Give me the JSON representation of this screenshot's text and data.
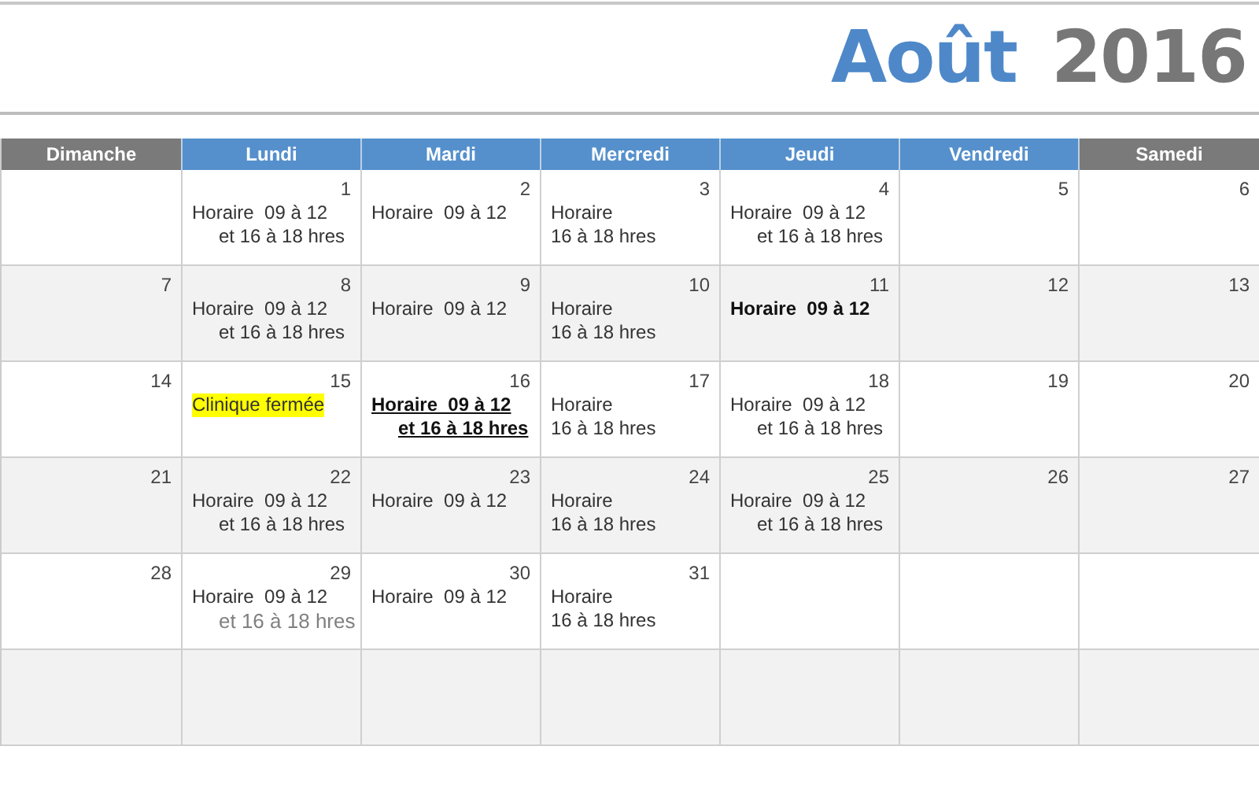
{
  "title": {
    "month": "Août",
    "year": "2016"
  },
  "weekdays": [
    {
      "label": "Dimanche",
      "weekend": true
    },
    {
      "label": "Lundi",
      "weekend": false
    },
    {
      "label": "Mardi",
      "weekend": false
    },
    {
      "label": "Mercredi",
      "weekend": false
    },
    {
      "label": "Jeudi",
      "weekend": false
    },
    {
      "label": "Vendredi",
      "weekend": false
    },
    {
      "label": "Samedi",
      "weekend": true
    }
  ],
  "weeks": [
    {
      "shaded": false,
      "days": [
        {
          "kind": "blank"
        },
        {
          "kind": "day",
          "day": "1",
          "lines": [
            {
              "text": "Horaire  09 à 12",
              "kind": "normal",
              "indent": false
            },
            {
              "text": "et 16 à 18 hres",
              "kind": "normal",
              "indent": true
            }
          ]
        },
        {
          "kind": "day",
          "day": "2",
          "lines": [
            {
              "text": "Horaire  09 à 12",
              "kind": "normal",
              "indent": false
            }
          ]
        },
        {
          "kind": "day",
          "day": "3",
          "lines": [
            {
              "text": "Horaire",
              "kind": "normal",
              "indent": false
            },
            {
              "text": "16 à 18 hres",
              "kind": "normal",
              "indent": false
            }
          ]
        },
        {
          "kind": "day",
          "day": "4",
          "lines": [
            {
              "text": "Horaire  09 à 12",
              "kind": "normal",
              "indent": false
            },
            {
              "text": "et 16 à 18 hres",
              "kind": "normal",
              "indent": true
            }
          ]
        },
        {
          "kind": "day",
          "day": "5"
        },
        {
          "kind": "day",
          "day": "6"
        }
      ]
    },
    {
      "shaded": true,
      "days": [
        {
          "kind": "day",
          "day": "7"
        },
        {
          "kind": "day",
          "day": "8",
          "lines": [
            {
              "text": "Horaire  09 à 12",
              "kind": "normal",
              "indent": false
            },
            {
              "text": "et 16 à 18 hres",
              "kind": "normal",
              "indent": true
            }
          ]
        },
        {
          "kind": "day",
          "day": "9",
          "lines": [
            {
              "text": "Horaire  09 à 12",
              "kind": "normal",
              "indent": false
            }
          ]
        },
        {
          "kind": "day",
          "day": "10",
          "lines": [
            {
              "text": "Horaire",
              "kind": "normal",
              "indent": false
            },
            {
              "text": "16 à 18 hres",
              "kind": "normal",
              "indent": false
            }
          ]
        },
        {
          "kind": "day",
          "day": "11",
          "lines": [
            {
              "text": "Horaire  09 à 12",
              "kind": "bold",
              "indent": false
            }
          ]
        },
        {
          "kind": "day",
          "day": "12"
        },
        {
          "kind": "day",
          "day": "13"
        }
      ]
    },
    {
      "shaded": false,
      "days": [
        {
          "kind": "day",
          "day": "14"
        },
        {
          "kind": "day",
          "day": "15",
          "lines": [
            {
              "text": "Clinique fermée",
              "kind": "highlight",
              "indent": false
            }
          ]
        },
        {
          "kind": "day",
          "day": "16",
          "lines": [
            {
              "text": "Horaire  09 à 12",
              "kind": "underlined",
              "indent": false
            },
            {
              "text": "et 16 à 18 hres",
              "kind": "underlined",
              "indent": true
            }
          ]
        },
        {
          "kind": "day",
          "day": "17",
          "lines": [
            {
              "text": "Horaire",
              "kind": "normal",
              "indent": false
            },
            {
              "text": "16 à 18 hres",
              "kind": "normal",
              "indent": false
            }
          ]
        },
        {
          "kind": "day",
          "day": "18",
          "lines": [
            {
              "text": "Horaire  09 à 12",
              "kind": "normal",
              "indent": false
            },
            {
              "text": "et 16 à 18 hres",
              "kind": "normal",
              "indent": true
            }
          ]
        },
        {
          "kind": "day",
          "day": "19"
        },
        {
          "kind": "day",
          "day": "20"
        }
      ]
    },
    {
      "shaded": true,
      "days": [
        {
          "kind": "day",
          "day": "21"
        },
        {
          "kind": "day",
          "day": "22",
          "lines": [
            {
              "text": "Horaire  09 à 12",
              "kind": "normal",
              "indent": false
            },
            {
              "text": "et 16 à 18 hres",
              "kind": "normal",
              "indent": true
            }
          ]
        },
        {
          "kind": "day",
          "day": "23",
          "lines": [
            {
              "text": "Horaire  09 à 12",
              "kind": "normal",
              "indent": false
            }
          ]
        },
        {
          "kind": "day",
          "day": "24",
          "lines": [
            {
              "text": "Horaire",
              "kind": "normal",
              "indent": false
            },
            {
              "text": "16 à 18 hres",
              "kind": "normal",
              "indent": false
            }
          ]
        },
        {
          "kind": "day",
          "day": "25",
          "lines": [
            {
              "text": "Horaire  09 à 12",
              "kind": "normal",
              "indent": false
            },
            {
              "text": "et 16 à 18 hres",
              "kind": "normal",
              "indent": true
            }
          ]
        },
        {
          "kind": "day",
          "day": "26"
        },
        {
          "kind": "day",
          "day": "27"
        }
      ]
    },
    {
      "shaded": false,
      "days": [
        {
          "kind": "day",
          "day": "28"
        },
        {
          "kind": "day",
          "day": "29",
          "lines": [
            {
              "text": "Horaire  09 à 12",
              "kind": "normal",
              "indent": false
            },
            {
              "text": "et 16 à 18 hres",
              "kind": "muted",
              "indent": true
            }
          ]
        },
        {
          "kind": "day",
          "day": "30",
          "lines": [
            {
              "text": "Horaire  09 à 12",
              "kind": "normal",
              "indent": false
            }
          ]
        },
        {
          "kind": "day",
          "day": "31",
          "lines": [
            {
              "text": "Horaire",
              "kind": "normal",
              "indent": false
            },
            {
              "text": "16 à 18 hres",
              "kind": "normal",
              "indent": false
            }
          ]
        },
        {
          "kind": "blank"
        },
        {
          "kind": "blank"
        },
        {
          "kind": "blank"
        }
      ]
    },
    {
      "shaded": true,
      "days": [
        {
          "kind": "blank"
        },
        {
          "kind": "blank"
        },
        {
          "kind": "blank"
        },
        {
          "kind": "blank"
        },
        {
          "kind": "blank"
        },
        {
          "kind": "blank"
        },
        {
          "kind": "blank"
        }
      ]
    }
  ]
}
